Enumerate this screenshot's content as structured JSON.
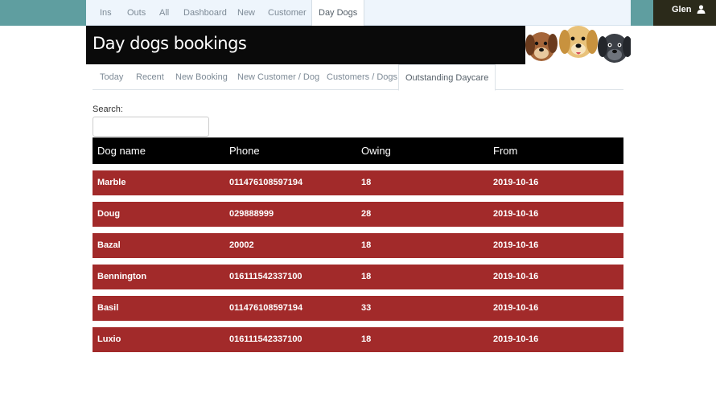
{
  "top_nav": {
    "tabs": [
      {
        "label": "Ins",
        "active": false
      },
      {
        "label": "Outs",
        "active": false
      },
      {
        "label": "All",
        "active": false
      },
      {
        "label": "Dashboard",
        "active": false
      },
      {
        "label": "New",
        "active": false
      },
      {
        "label": "Customer",
        "active": false
      },
      {
        "label": "Day Dogs",
        "active": true
      }
    ]
  },
  "user": {
    "name": "Glen",
    "icon": "user-icon"
  },
  "banner": {
    "title": "Day dogs bookings",
    "image": "cartoon-dogs"
  },
  "sub_nav": {
    "tabs": [
      {
        "label": "Today",
        "active": false
      },
      {
        "label": "Recent",
        "active": false
      },
      {
        "label": "New Booking",
        "active": false
      },
      {
        "label": "New Customer / Dog",
        "active": false
      },
      {
        "label": "Customers / Dogs",
        "active": false
      },
      {
        "label": "Outstanding Daycare",
        "active": true
      }
    ]
  },
  "search": {
    "label": "Search:",
    "value": "",
    "placeholder": ""
  },
  "table": {
    "columns": [
      "Dog name",
      "Phone",
      "Owing",
      "From"
    ],
    "rows": [
      {
        "dog": "Marble",
        "phone": "011476108597194",
        "owing": "18",
        "from": "2019-10-16"
      },
      {
        "dog": "Doug",
        "phone": "029888999",
        "owing": "28",
        "from": "2019-10-16"
      },
      {
        "dog": "Bazal",
        "phone": "20002",
        "owing": "18",
        "from": "2019-10-16"
      },
      {
        "dog": "Bennington",
        "phone": "016111542337100",
        "owing": "18",
        "from": "2019-10-16"
      },
      {
        "dog": "Basil",
        "phone": "011476108597194",
        "owing": "33",
        "from": "2019-10-16"
      },
      {
        "dog": "Luxio",
        "phone": "016111542337100",
        "owing": "18",
        "from": "2019-10-16"
      }
    ]
  },
  "colors": {
    "row_bg": "#a22a2a",
    "header_bg": "#000000",
    "top_accent": "#5f9ea0"
  }
}
